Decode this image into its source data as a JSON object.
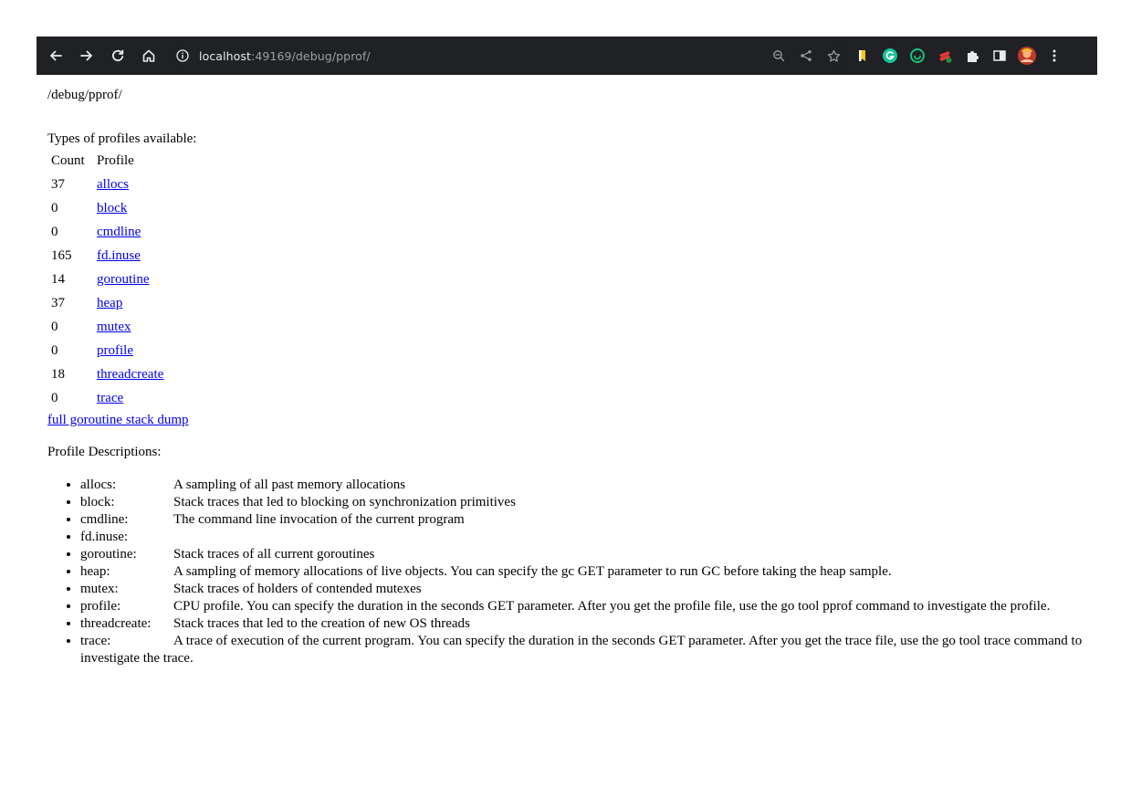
{
  "browser": {
    "url_host": "localhost",
    "url_rest": ":49169/debug/pprof/"
  },
  "page": {
    "path": "/debug/pprof/",
    "types_label": "Types of profiles available:",
    "table_headers": [
      "Count",
      "Profile"
    ],
    "profiles": [
      {
        "count": "37",
        "name": "allocs"
      },
      {
        "count": "0",
        "name": "block"
      },
      {
        "count": "0",
        "name": "cmdline"
      },
      {
        "count": "165",
        "name": "fd.inuse"
      },
      {
        "count": "14",
        "name": "goroutine"
      },
      {
        "count": "37",
        "name": "heap"
      },
      {
        "count": "0",
        "name": "mutex"
      },
      {
        "count": "0",
        "name": "profile"
      },
      {
        "count": "18",
        "name": "threadcreate"
      },
      {
        "count": "0",
        "name": "trace"
      }
    ],
    "full_dump_link": "full goroutine stack dump",
    "desc_label": "Profile Descriptions:",
    "descriptions": [
      {
        "term": "allocs:",
        "text": "A sampling of all past memory allocations"
      },
      {
        "term": "block:",
        "text": "Stack traces that led to blocking on synchronization primitives"
      },
      {
        "term": "cmdline:",
        "text": "The command line invocation of the current program"
      },
      {
        "term": "fd.inuse:",
        "text": ""
      },
      {
        "term": "goroutine:",
        "text": "Stack traces of all current goroutines"
      },
      {
        "term": "heap:",
        "text": "A sampling of memory allocations of live objects. You can specify the gc GET parameter to run GC before taking the heap sample."
      },
      {
        "term": "mutex:",
        "text": "Stack traces of holders of contended mutexes"
      },
      {
        "term": "profile:",
        "text": "CPU profile. You can specify the duration in the seconds GET parameter. After you get the profile file, use the go tool pprof command to investigate the profile."
      },
      {
        "term": "threadcreate:",
        "text": "Stack traces that led to the creation of new OS threads"
      },
      {
        "term": "trace:",
        "text": "A trace of execution of the current program. You can specify the duration in the seconds GET parameter. After you get the trace file, use the go tool trace command to investigate the trace."
      }
    ]
  },
  "colors": {
    "toolbar_bg": "#202124",
    "link": "#0000ee"
  }
}
